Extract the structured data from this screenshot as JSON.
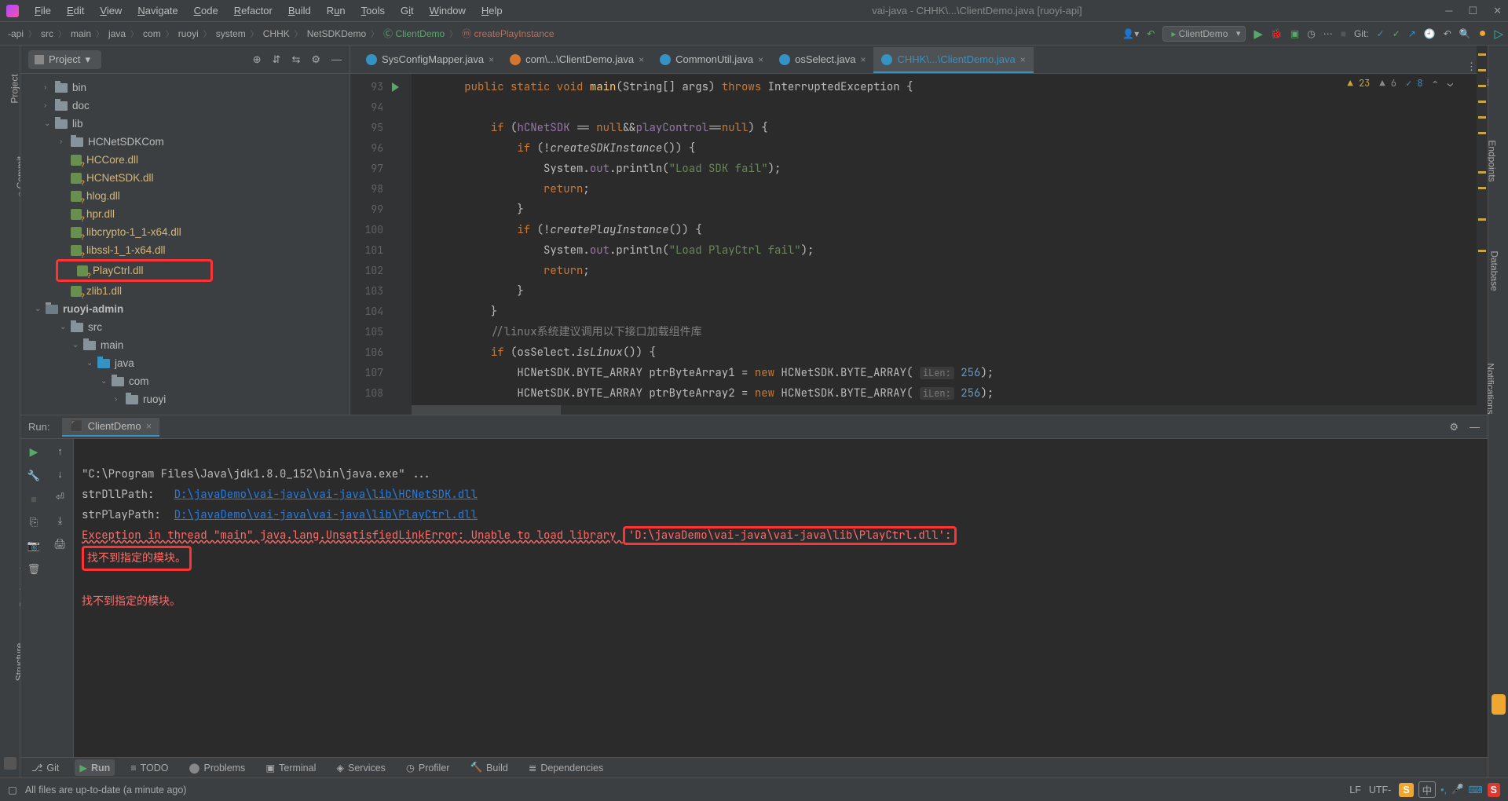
{
  "window": {
    "title": "vai-java - CHHK\\...\\ClientDemo.java [ruoyi-api]"
  },
  "menus": [
    "File",
    "Edit",
    "View",
    "Navigate",
    "Code",
    "Refactor",
    "Build",
    "Run",
    "Tools",
    "Git",
    "Window",
    "Help"
  ],
  "breadcrumb": [
    "-api",
    "src",
    "main",
    "java",
    "com",
    "ruoyi",
    "system",
    "CHHK",
    "NetSDKDemo"
  ],
  "breadcrumb_class": "ClientDemo",
  "breadcrumb_method": "createPlayInstance",
  "run_config": "ClientDemo",
  "git_label": "Git:",
  "project_panel": {
    "title": "Project"
  },
  "tree": {
    "bin": "bin",
    "doc": "doc",
    "lib": "lib",
    "hcnet": "HCNetSDKCom",
    "f1": "HCCore.dll",
    "f2": "HCNetSDK.dll",
    "f3": "hlog.dll",
    "f4": "hpr.dll",
    "f5": "libcrypto-1_1-x64.dll",
    "f6": "libssl-1_1-x64.dll",
    "f7": "PlayCtrl.dll",
    "f8": "zlib1.dll",
    "ra": "ruoyi-admin",
    "src": "src",
    "main": "main",
    "java": "java",
    "com": "com",
    "ruoyi": "ruoyi"
  },
  "editor_tabs": [
    {
      "label": "SysConfigMapper.java",
      "color": "blue"
    },
    {
      "label": "com\\...\\ClientDemo.java",
      "color": "orange"
    },
    {
      "label": "CommonUtil.java",
      "color": "blue"
    },
    {
      "label": "osSelect.java",
      "color": "blue"
    },
    {
      "label": "CHHK\\...\\ClientDemo.java",
      "color": "blue",
      "active": true
    }
  ],
  "gutter_start": 93,
  "code_lines": [
    "        <kw>public static void</kw> <ident>main</ident>(String[] args) <kw>throws</kw> InterruptedException {",
    "",
    "            <kw>if</kw> (<field>hCNetSDK</field> == <kw>null</kw>&&<field>playControl</field>==<kw>null</kw>) {",
    "                <kw>if</kw> (!<static-m>createSDKInstance</static-m>()) {",
    "                    System.<field>out</field>.println(<str>\"Load SDK fail\"</str>);",
    "                    <kw>return</kw>;",
    "                }",
    "                <kw>if</kw> (!<static-m>createPlayInstance</static-m>()) {",
    "                    System.<field>out</field>.println(<str>\"Load PlayCtrl fail\"</str>);",
    "                    <kw>return</kw>;",
    "                }",
    "            }",
    "            <cmt>//linux系统建议调用以下接口加载组件库</cmt>",
    "            <kw>if</kw> (osSelect.<static-m>isLinux</static-m>()) {",
    "                HCNetSDK.BYTE_ARRAY ptrByteArray1 = <kw>new</kw> HCNetSDK.BYTE_ARRAY( <hint>iLen:</hint> <num>256</num>);",
    "                HCNetSDK.BYTE_ARRAY ptrByteArray2 = <kw>new</kw> HCNetSDK.BYTE_ARRAY( <hint>iLen:</hint> <num>256</num>);"
  ],
  "inspection": {
    "errors": "23",
    "warnings": "6",
    "typos": "8"
  },
  "run": {
    "label": "Run:",
    "tab": "ClientDemo",
    "lines": {
      "cmd": "\"C:\\Program Files\\Java\\jdk1.8.0_152\\bin\\java.exe\" ...",
      "dll_label": "strDllPath:   ",
      "dll_link": "D:\\javaDemo\\vai-java\\vai-java\\lib\\HCNetSDK.dll",
      "play_label": "strPlayPath:  ",
      "play_link": "D:\\javaDemo\\vai-java\\vai-java\\lib\\PlayCtrl.dll",
      "exc_pre": "Exception in thread \"main\" java.lang.UnsatisfiedLinkError: Unable to load library ",
      "exc_path": "'D:\\javaDemo\\vai-java\\vai-java\\lib\\PlayCtrl.dll':",
      "exc_msg": "找不到指定的模块。",
      "exc_msg2": "找不到指定的模块。"
    }
  },
  "bottom_tabs": [
    "Git",
    "Run",
    "TODO",
    "Problems",
    "Terminal",
    "Services",
    "Profiler",
    "Build",
    "Dependencies"
  ],
  "status": {
    "vcs": "All files are up-to-date (a minute ago)",
    "lf": "LF",
    "enc": "UTF-",
    "cn": "中"
  },
  "side_tabs": {
    "project": "Project",
    "commit": "Commit",
    "bookmarks": "Bookmarks",
    "structure": "Structure",
    "maven": "m",
    "endpoints": "Endpoints",
    "database": "Database",
    "notifications": "Notifications"
  }
}
